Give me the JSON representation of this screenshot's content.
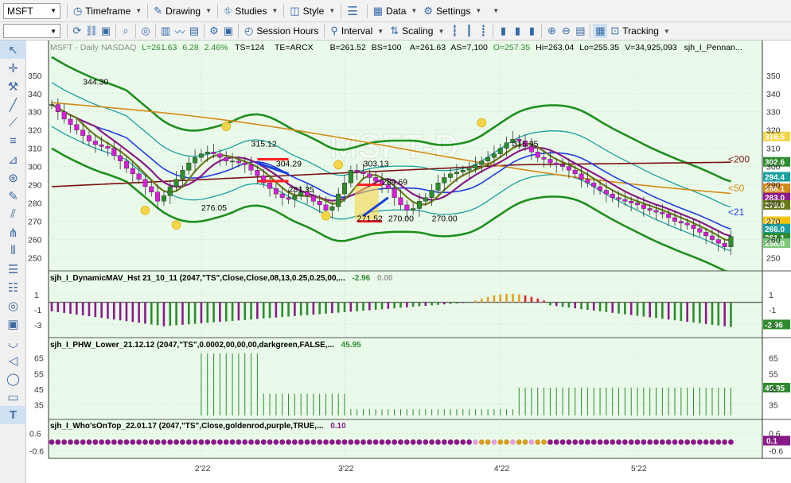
{
  "toolbar_top": {
    "symbol": "MSFT",
    "items": [
      {
        "name": "timeframe",
        "label": "Timeframe",
        "icon": "clock-icon"
      },
      {
        "name": "drawing",
        "label": "Drawing",
        "icon": "pencil-icon"
      },
      {
        "name": "studies",
        "label": "Studies",
        "icon": "studies-icon"
      },
      {
        "name": "style",
        "label": "Style",
        "icon": "palette-icon"
      },
      {
        "name": "data",
        "label": "Data",
        "icon": "grid-icon"
      },
      {
        "name": "settings",
        "label": "Settings",
        "icon": "gear-icon"
      }
    ]
  },
  "toolbar_second": {
    "session_hours": "Session Hours",
    "interval": "Interval",
    "scaling": "Scaling",
    "tracking": "Tracking"
  },
  "header": {
    "symbol_info": "MSFT - Daily  NASDAQ",
    "L": "L=261.63",
    "chg": "6.28",
    "pct": "2.46%",
    "ts": "TS=124",
    "te": "TE=ARCX",
    "B": "B=261.52",
    "BS": "BS=100",
    "A": "A=261.63",
    "AS": "AS=7,100",
    "O": "O=257.35",
    "Hi": "Hi=263.04",
    "Lo": "Lo=255.35",
    "V": "V=34,925,093",
    "study": "sjh_I_Pennan..."
  },
  "watermark": "MSFT-D",
  "chart_data": [
    {
      "type": "candlestick",
      "panel": "price",
      "y_ticks": [
        250,
        260,
        270,
        280,
        290,
        300,
        310,
        320,
        330,
        340,
        350
      ],
      "ylim": [
        245,
        356
      ],
      "x_ticks": [
        "2'22",
        "3'22",
        "4'22",
        "5'22"
      ],
      "start_close": 334,
      "closes": [
        334,
        330,
        326,
        323,
        320,
        317,
        314,
        312,
        311,
        310,
        306,
        303,
        299,
        296,
        293,
        289,
        286,
        281,
        284,
        289,
        293,
        298,
        302,
        305,
        307,
        308,
        307,
        305,
        303,
        303,
        302,
        301,
        298,
        295,
        291,
        288,
        285,
        283,
        282,
        284,
        286,
        284,
        281,
        279,
        276,
        278,
        285,
        291,
        298,
        297,
        296,
        294,
        292,
        290,
        288,
        283,
        279,
        276,
        277,
        281,
        283,
        287,
        291,
        294,
        296,
        297,
        298,
        299,
        301,
        303,
        305,
        307,
        310,
        313,
        315,
        314,
        311,
        308,
        305,
        304,
        302,
        301,
        300,
        298,
        296,
        293,
        291,
        289,
        287,
        285,
        283,
        282,
        281,
        280,
        279,
        277,
        276,
        275,
        274,
        272,
        270,
        269,
        268,
        266,
        264,
        262,
        260,
        258,
        256,
        261.63
      ],
      "annotations": [
        "344.30",
        "315.12",
        "304.29",
        "281.35",
        "276.05",
        "303.13",
        "289.69",
        "271.52",
        "270.00",
        "270.00",
        "315.95"
      ],
      "ma_labels": [
        "<200",
        "<50",
        "<21"
      ],
      "right_tags": [
        {
          "text": "316.5",
          "price": 316.5,
          "color": "#f5d547"
        },
        {
          "text": "302.6",
          "price": 302.6,
          "color": "#2e8b2e"
        },
        {
          "text": "294.4",
          "price": 294.4,
          "color": "#1aa0a0"
        },
        {
          "text": "288.1",
          "price": 288.1,
          "color": "#d48a18"
        },
        {
          "text": "283.0",
          "price": 283.0,
          "color": "#8a1a8a"
        },
        {
          "text": "279.0",
          "price": 279.0,
          "color": "#6b7a1a"
        },
        {
          "text": "270",
          "price": 270.0,
          "color": "#f5c400"
        },
        {
          "text": "266.0",
          "price": 266.0,
          "color": "#1aa0a0"
        },
        {
          "text": "261.1",
          "price": 261.1,
          "color": "#2e8b2e"
        },
        {
          "text": "258.0",
          "price": 258.0,
          "color": "#7cc87c"
        }
      ]
    },
    {
      "type": "histogram",
      "panel": "dynamic_mav",
      "title": "sjh_I_DynamicMAV_Hst 21_10_11 (2047,\"TS\",Close,Close,08,13,0.25,0.25,00,...",
      "value1": "-2.96",
      "value2": "0.00",
      "y_ticks": [
        "1",
        "-1",
        "-3"
      ],
      "current": "-2.96",
      "current_value": -2.96,
      "ylim": [
        -4.3,
        2.3
      ]
    },
    {
      "type": "bar",
      "panel": "phw_lower",
      "title": "sjh_I_PHW_Lower_21.12.12 (2047,\"TS\",0.0002,00,00,00,darkgreen,FALSE,...",
      "value1": "45.95",
      "y_ticks": [
        "65",
        "55",
        "45",
        "35"
      ],
      "current": "45.95",
      "current_value": 45.95,
      "ylim": [
        28,
        71
      ]
    },
    {
      "type": "dots",
      "panel": "whos_on_top",
      "title": "sjh_I_Who'sOnTop_22.01.17 (2047,\"TS\",Close,goldenrod,purple,TRUE,...",
      "value1": "0.10",
      "y_ticks": [
        "0.6",
        "-0.6"
      ],
      "current": "0.1",
      "current_value": 0.1,
      "ylim": [
        -0.95,
        0.95
      ]
    }
  ],
  "left_tools": [
    "cursor-icon",
    "crosshair-icon",
    "tools-icon",
    "line-icon",
    "line-icon",
    "ray-icon",
    "fibonacci-icon",
    "gann-icon",
    "target-icon",
    "pencil-icon",
    "channel-icon",
    "pitchfork-icon",
    "bars-icon",
    "lines-icon",
    "circle-target-icon",
    "rect-icon",
    "arc-icon",
    "arrow-icon",
    "ellipse-icon",
    "rectangle-icon",
    "text-icon"
  ]
}
